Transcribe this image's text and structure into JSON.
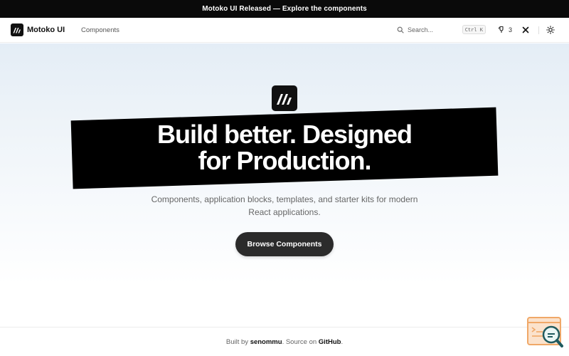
{
  "announcement": {
    "text": "Motoko UI Released — Explore the components"
  },
  "navbar": {
    "brand_name": "Motoko UI",
    "links": [
      {
        "label": "Components"
      }
    ],
    "search": {
      "placeholder": "Search...",
      "shortcut": "Ctrl K"
    },
    "github": {
      "count": "3",
      "icon": "github-icon"
    },
    "x_icon": "x-icon",
    "theme_icon": "sun-icon"
  },
  "hero": {
    "headline_line1": "Build better. Designed",
    "headline_line2": "for Production.",
    "subtitle_line1": "Components, application blocks, templates, and starter kits for modern",
    "subtitle_line2": "React applications.",
    "cta_label": "Browse Components"
  },
  "footer": {
    "prefix": "Built by",
    "author": "senommu",
    "middle": ". Source on",
    "source": "GitHub",
    "suffix": "."
  },
  "colors": {
    "announcement_bg": "#0a0a0a",
    "banner_bg": "#000000",
    "cta_bg": "#2b2b2b",
    "widget_accent": "#f0a868",
    "widget_teal": "#1f5a5e"
  }
}
